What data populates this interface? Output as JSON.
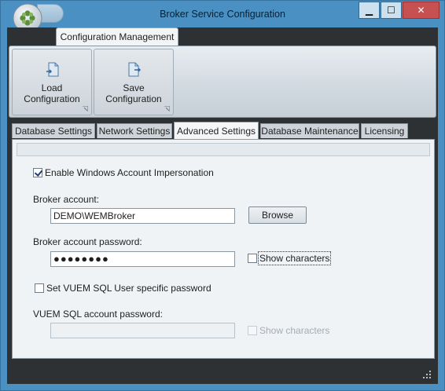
{
  "window": {
    "title": "Broker Service Configuration",
    "controls": {
      "minimize": "▁",
      "maximize": "☐",
      "close": "✕"
    }
  },
  "ribbon": {
    "tab_label": "Configuration Management",
    "buttons": [
      {
        "label": "Load Configuration",
        "icon": "load-config-icon"
      },
      {
        "label": "Save Configuration",
        "icon": "save-config-icon"
      }
    ]
  },
  "tabs": [
    {
      "label": "Database Settings",
      "active": false
    },
    {
      "label": "Network Settings",
      "active": false
    },
    {
      "label": "Advanced Settings",
      "active": true
    },
    {
      "label": "Database Maintenance",
      "active": false
    },
    {
      "label": "Licensing",
      "active": false
    }
  ],
  "advanced": {
    "impersonation": {
      "label": "Enable Windows Account Impersonation",
      "checked": true
    },
    "broker_account": {
      "label": "Broker account:",
      "value": "DEMO\\WEMBroker",
      "browse_label": "Browse"
    },
    "broker_password": {
      "label": "Broker account password:",
      "value": "●●●●●●●●",
      "show_chars_label": "Show characters",
      "show_chars_checked": false
    },
    "sql_specific": {
      "label": "Set VUEM SQL User specific password",
      "checked": false
    },
    "sql_password": {
      "label": "VUEM SQL account password:",
      "value": "",
      "show_chars_label": "Show characters",
      "show_chars_checked": false,
      "enabled": false
    }
  },
  "colors": {
    "title_bar": "#4a90c2",
    "frame": "#2d3134",
    "close_button": "#c75050"
  }
}
